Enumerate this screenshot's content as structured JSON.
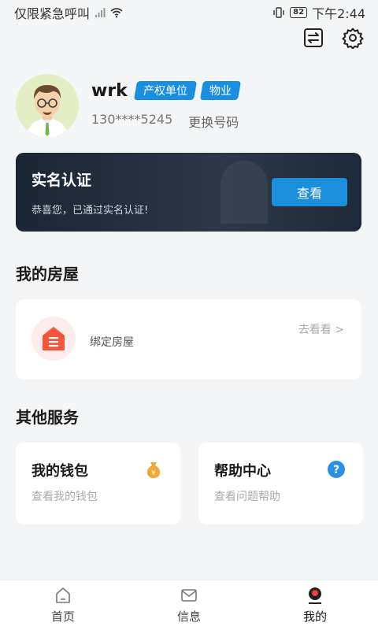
{
  "status_bar": {
    "carrier": "仅限紧急呼叫",
    "battery": "82",
    "time": "下午2:44"
  },
  "header": {
    "icons": [
      "switch-icon",
      "settings-icon"
    ]
  },
  "profile": {
    "name": "wrk",
    "tags": [
      "产权单位",
      "物业"
    ],
    "phone": "130****5245",
    "change_phone_label": "更换号码"
  },
  "verify": {
    "title": "实名认证",
    "subtitle": "恭喜您，已通过实名认证!",
    "button_label": "查看"
  },
  "my_house": {
    "section_title": "我的房屋",
    "label": "绑定房屋",
    "link": "去看看 >"
  },
  "services": {
    "section_title": "其他服务",
    "items": [
      {
        "title": "我的钱包",
        "subtitle": "查看我的钱包",
        "icon": "money-bag-icon",
        "accent": "#f0a934"
      },
      {
        "title": "帮助中心",
        "subtitle": "查看问题帮助",
        "icon": "help-icon",
        "accent": "#2a8fe6"
      }
    ]
  },
  "tabbar": {
    "items": [
      {
        "label": "首页",
        "icon": "home-icon"
      },
      {
        "label": "信息",
        "icon": "message-icon"
      },
      {
        "label": "我的",
        "icon": "profile-icon"
      }
    ],
    "active_index": 2
  },
  "colors": {
    "accent": "#1b8fdc",
    "house_icon": "#f4553b"
  }
}
